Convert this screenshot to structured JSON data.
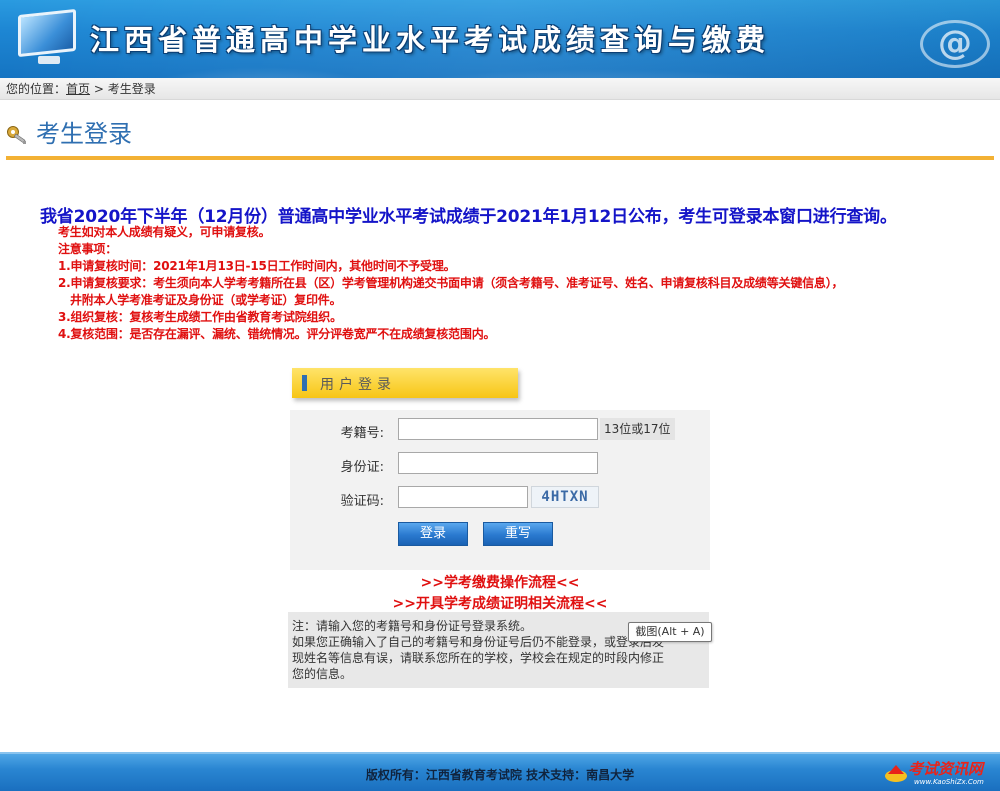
{
  "header": {
    "title": "江西省普通高中学业水平考试成绩查询与缴费",
    "icons": [
      "monitor-icon",
      "at-sign-icon"
    ]
  },
  "breadcrumb": {
    "prefix": "您的位置：",
    "home": "首页",
    "separator": " > ",
    "current": "考生登录"
  },
  "page": {
    "title": "考生登录",
    "icon": "key-icon"
  },
  "announcement": {
    "headline": "我省2020年下半年（12月份）普通高中学业水平考试成绩于2021年1月12日公布，考生可登录本窗口进行查询。",
    "notes": [
      "考生如对本人成绩有疑义，可申请复核。",
      "注意事项：",
      "1.申请复核时间：2021年1月13日-15日工作时间内，其他时间不予受理。",
      "2.申请复核要求：考生须向本人学考考籍所在县（区）学考管理机构递交书面申请（须含考籍号、准考证号、姓名、申请复核科目及成绩等关键信息），",
      "井附本人学考准考证及身份证（或学考证）复印件。",
      "3.组织复核：复核考生成绩工作由省教育考试院组织。",
      "4.复核范围：是否存在漏评、漏统、错统情况。评分评卷宽严不在成绩复核范围内。"
    ]
  },
  "login": {
    "tab_label": "用户登录",
    "fields": {
      "exam_no_label": "考籍号:",
      "exam_no_value": "",
      "exam_no_hint": "13位或17位",
      "id_label": "身份证:",
      "id_value": "",
      "captcha_label": "验证码:",
      "captcha_value": "",
      "captcha_code": "4HTXN"
    },
    "buttons": {
      "login": "登录",
      "reset": "重写"
    }
  },
  "links": {
    "fee_flow": ">>学考缴费操作流程<<",
    "cert_flow": ">>开具学考成绩证明相关流程<<"
  },
  "note": {
    "lines": [
      "注：请输入您的考籍号和身份证号登录系统。",
      "如果您正确输入了自己的考籍号和身份证号后仍不能登录，或登录后发",
      "现姓名等信息有误，请联系您所在的学校，学校会在规定的时段内修正",
      "您的信息。"
    ]
  },
  "tooltip": {
    "text": "截图(Alt + A)"
  },
  "footer": {
    "text": "版权所有：江西省教育考试院 技术支持：南昌大学",
    "logo_name": "考试资讯网",
    "logo_url": "www.KaoShiZx.Com"
  },
  "colors": {
    "banner_blue": "#1d86d3",
    "title_blue": "#2f6fb1",
    "rule_orange": "#f3b134",
    "headline_blue": "#1414c8",
    "notice_red": "#e01010"
  }
}
